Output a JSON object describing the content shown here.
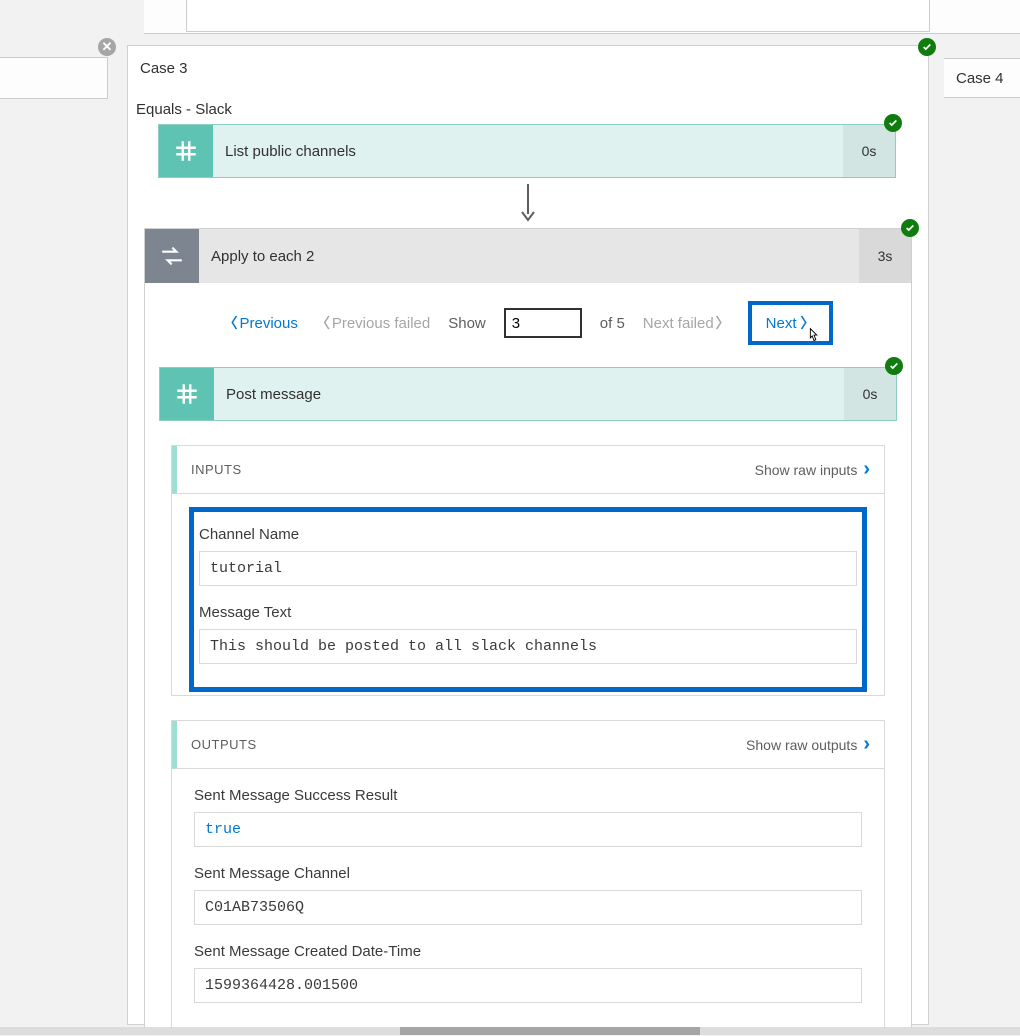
{
  "leftCase": "",
  "rightCase": "Case 4",
  "case": {
    "title": "Case 3",
    "condition": "Equals - Slack"
  },
  "listChannels": {
    "label": "List public channels",
    "duration": "0s"
  },
  "applyEach": {
    "label": "Apply to each 2",
    "duration": "3s"
  },
  "pager": {
    "previous": "Previous",
    "previousFailed": "Previous failed",
    "show": "Show",
    "value": "3",
    "of": "of 5",
    "nextFailed": "Next failed",
    "next": "Next"
  },
  "postMessage": {
    "label": "Post message",
    "duration": "0s"
  },
  "inputs": {
    "header": "INPUTS",
    "rawLink": "Show raw inputs",
    "fields": {
      "channelName": {
        "label": "Channel Name",
        "value": "tutorial"
      },
      "messageText": {
        "label": "Message Text",
        "value": "This should be posted to all slack channels"
      }
    }
  },
  "outputs": {
    "header": "OUTPUTS",
    "rawLink": "Show raw outputs",
    "fields": {
      "success": {
        "label": "Sent Message Success Result",
        "value": "true"
      },
      "channel": {
        "label": "Sent Message Channel",
        "value": "C01AB73506Q"
      },
      "created": {
        "label": "Sent Message Created Date-Time",
        "value": "1599364428.001500"
      }
    }
  }
}
